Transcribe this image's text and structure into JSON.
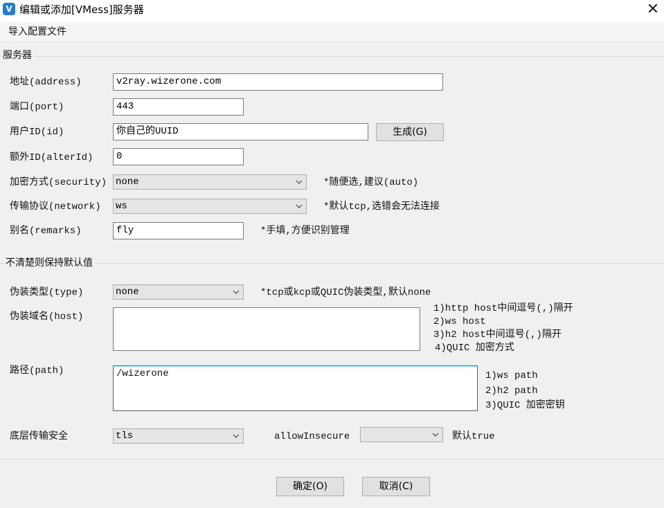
{
  "window": {
    "icon": "V",
    "title": "编辑或添加[VMess]服务器",
    "close_glyph": "✕"
  },
  "menu": {
    "import_label": "导入配置文件"
  },
  "server_group": {
    "title": "服务器",
    "address_label": "地址(address)",
    "address_value": "v2ray.wizerone.com",
    "port_label": "端口(port)",
    "port_value": "443",
    "id_label": "用户ID(id)",
    "id_value": "你自己的UUID",
    "generate_label": "生成(G)",
    "alterid_label": "额外ID(alterId)",
    "alterid_value": "0",
    "security_label": "加密方式(security)",
    "security_value": "none",
    "security_note": "*随便选,建议(auto)",
    "network_label": "传输协议(network)",
    "network_value": "ws",
    "network_note": "*默认tcp,选错会无法连接",
    "remarks_label": "别名(remarks)",
    "remarks_value": "fly",
    "remarks_note": "*手填,方便识别管理"
  },
  "advanced_group": {
    "title": "不清楚则保持默认值",
    "type_label": "伪装类型(type)",
    "type_value": "none",
    "type_note": "*tcp或kcp或QUIC伪装类型,默认none",
    "host_label": "伪装域名(host)",
    "host_value": "",
    "host_notes": [
      "1)http host中间逗号(,)隔开",
      "2)ws host",
      "3)h2 host中间逗号(,)隔开",
      "4)QUIC 加密方式"
    ],
    "path_label": "路径(path)",
    "path_value": "/wizerone",
    "path_notes": [
      "1)ws path",
      "2)h2 path",
      "3)QUIC 加密密钥"
    ],
    "tls_label": "底层传输安全",
    "tls_value": "tls",
    "allow_insecure_label": "allowInsecure",
    "allow_insecure_value": "",
    "allow_insecure_note": "默认true"
  },
  "footer": {
    "ok_label": "确定(O)",
    "cancel_label": "取消(C)"
  }
}
